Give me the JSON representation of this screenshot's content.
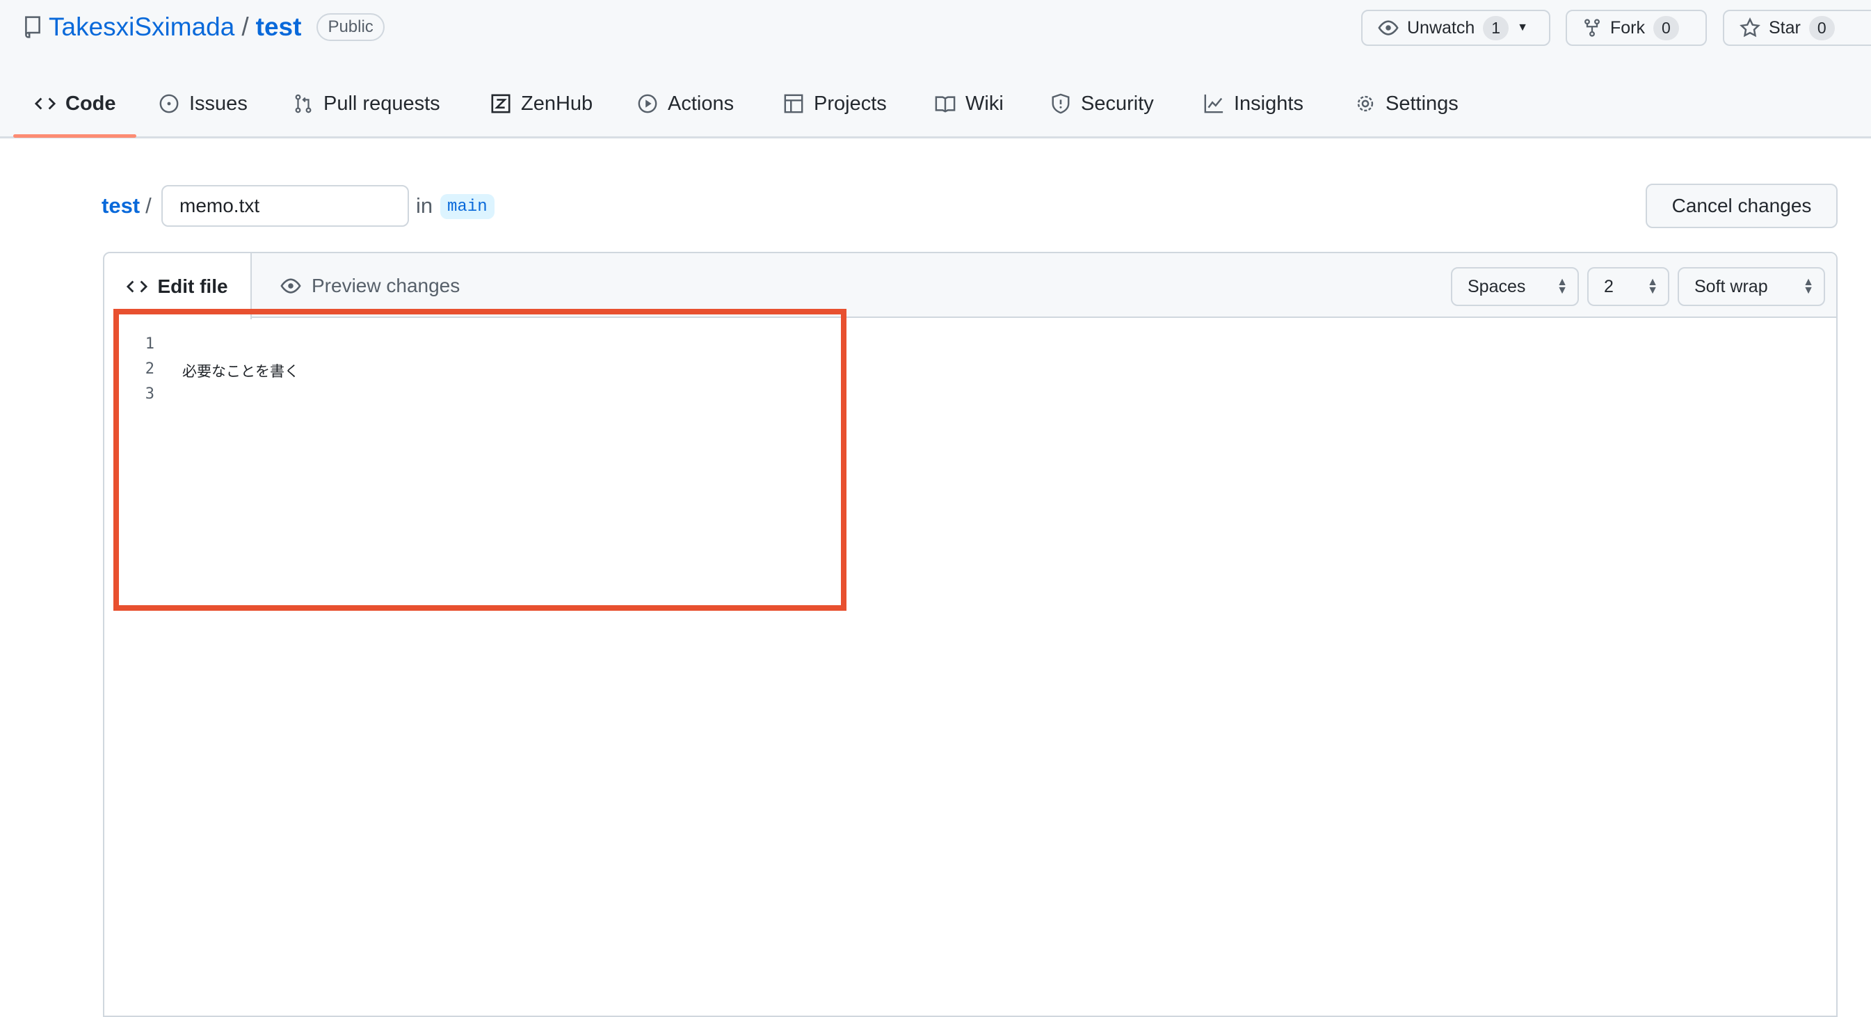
{
  "repo": {
    "owner": "TakesxiSximada",
    "separator": "/",
    "name": "test",
    "visibility": "Public"
  },
  "actions": {
    "watch": {
      "label": "Unwatch",
      "count": "1"
    },
    "fork": {
      "label": "Fork",
      "count": "0"
    },
    "star": {
      "label": "Star",
      "count": "0"
    }
  },
  "tabs": [
    {
      "label": "Code",
      "icon": "code-icon",
      "active": true
    },
    {
      "label": "Issues",
      "icon": "issue-icon"
    },
    {
      "label": "Pull requests",
      "icon": "pull-request-icon"
    },
    {
      "label": "ZenHub",
      "icon": "zenhub-icon"
    },
    {
      "label": "Actions",
      "icon": "play-icon"
    },
    {
      "label": "Projects",
      "icon": "table-icon"
    },
    {
      "label": "Wiki",
      "icon": "book-icon"
    },
    {
      "label": "Security",
      "icon": "shield-icon"
    },
    {
      "label": "Insights",
      "icon": "graph-icon"
    },
    {
      "label": "Settings",
      "icon": "gear-icon"
    }
  ],
  "breadcrumb": {
    "repo": "test",
    "separator": "/",
    "filename": "memo.txt",
    "in_label": "in",
    "branch": "main"
  },
  "cancel_label": "Cancel changes",
  "editor": {
    "edit_tab": "Edit file",
    "preview_tab": "Preview changes",
    "indent_mode": "Spaces",
    "indent_size": "2",
    "wrap_mode": "Soft wrap",
    "lines": [
      {
        "number": "1",
        "text": ""
      },
      {
        "number": "2",
        "text": "必要なことを書く"
      },
      {
        "number": "3",
        "text": ""
      }
    ]
  },
  "colors": {
    "accent": "#0969da",
    "tab_underline": "#fd8c73",
    "highlight_box": "#e8502f"
  }
}
